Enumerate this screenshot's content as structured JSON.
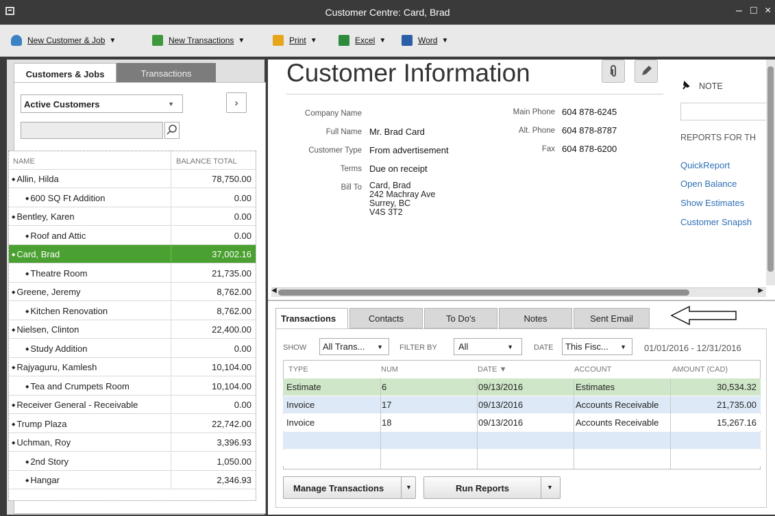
{
  "window": {
    "title": "Customer Centre: Card, Brad",
    "min": "–",
    "max": "□",
    "close": "×"
  },
  "toolbar": {
    "new_customer_job": "New Customer & Job",
    "new_transactions": "New Transactions",
    "print": "Print",
    "excel": "Excel",
    "word": "Word",
    "arrow": "▼"
  },
  "left": {
    "tab_customers": "Customers & Jobs",
    "tab_transactions": "Transactions",
    "filter_value": "Active Customers",
    "search_placeholder": "",
    "col_name": "NAME",
    "col_balance": "BALANCE TOTAL",
    "rows": [
      {
        "name": "Allin, Hilda",
        "balance": "78,750.00",
        "job": false
      },
      {
        "name": "600 SQ Ft Addition",
        "balance": "0.00",
        "job": true
      },
      {
        "name": "Bentley, Karen",
        "balance": "0.00",
        "job": false
      },
      {
        "name": "Roof and Attic",
        "balance": "0.00",
        "job": true
      },
      {
        "name": "Card, Brad",
        "balance": "37,002.16",
        "job": false,
        "selected": true
      },
      {
        "name": "Theatre Room",
        "balance": "21,735.00",
        "job": true
      },
      {
        "name": "Greene, Jeremy",
        "balance": "8,762.00",
        "job": false
      },
      {
        "name": "Kitchen Renovation",
        "balance": "8,762.00",
        "job": true
      },
      {
        "name": "Nielsen, Clinton",
        "balance": "22,400.00",
        "job": false
      },
      {
        "name": "Study Addition",
        "balance": "0.00",
        "job": true
      },
      {
        "name": "Rajyaguru, Kamlesh",
        "balance": "10,104.00",
        "job": false
      },
      {
        "name": "Tea and Crumpets Room",
        "balance": "10,104.00",
        "job": true
      },
      {
        "name": "Receiver General - Receivable",
        "balance": "0.00",
        "job": false
      },
      {
        "name": "Trump Plaza",
        "balance": "22,742.00",
        "job": false
      },
      {
        "name": "Uchman, Roy",
        "balance": "3,396.93",
        "job": false
      },
      {
        "name": "2nd Story",
        "balance": "1,050.00",
        "job": true
      },
      {
        "name": "Hangar",
        "balance": "2,346.93",
        "job": true
      }
    ]
  },
  "info": {
    "heading": "Customer Information",
    "company_name_label": "Company Name",
    "company_name": "",
    "full_name_label": "Full Name",
    "full_name": "Mr. Brad Card",
    "customer_type_label": "Customer Type",
    "customer_type": "From advertisement",
    "terms_label": "Terms",
    "terms": "Due on receipt",
    "bill_to_label": "Bill To",
    "bill_to": [
      "Card, Brad",
      "242 Machray Ave",
      "Surrey, BC",
      "V4S 3T2"
    ],
    "main_phone_label": "Main Phone",
    "main_phone": "604 878-6245",
    "alt_phone_label": "Alt. Phone",
    "alt_phone": "604 878-8787",
    "fax_label": "Fax",
    "fax": "604 878-6200",
    "note_label": "NOTE",
    "reports_label": "REPORTS FOR TH",
    "reports": [
      "QuickReport",
      "Open Balance",
      "Show Estimates",
      "Customer Snapsh"
    ]
  },
  "bottom": {
    "tabs": [
      "Transactions",
      "Contacts",
      "To Do's",
      "Notes",
      "Sent Email"
    ],
    "show_label": "SHOW",
    "show_value": "All Trans...",
    "filter_label": "FILTER BY",
    "filter_value": "All",
    "date_label": "DATE",
    "date_value": "This Fisc...",
    "date_range": "01/01/2016 - 12/31/2016",
    "columns": [
      "TYPE",
      "NUM",
      "DATE ▼",
      "ACCOUNT",
      "AMOUNT (CAD)"
    ],
    "rows": [
      {
        "type": "Estimate",
        "num": "6",
        "date": "09/13/2016",
        "account": "Estimates",
        "amount": "30,534.32"
      },
      {
        "type": "Invoice",
        "num": "17",
        "date": "09/13/2016",
        "account": "Accounts Receivable",
        "amount": "21,735.00"
      },
      {
        "type": "Invoice",
        "num": "18",
        "date": "09/13/2016",
        "account": "Accounts Receivable",
        "amount": "15,267.16"
      }
    ],
    "manage_btn": "Manage Transactions",
    "run_reports_btn": "Run Reports"
  }
}
